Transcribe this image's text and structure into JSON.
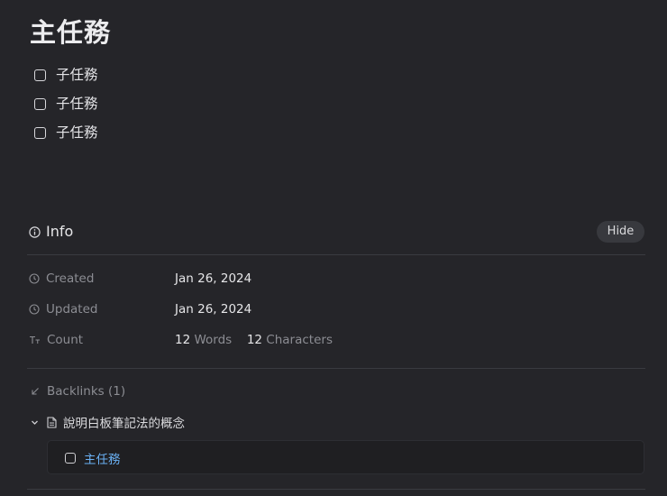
{
  "page": {
    "title": "主任務",
    "todos": [
      {
        "label": "子任務",
        "checked": false
      },
      {
        "label": "子任務",
        "checked": false
      },
      {
        "label": "子任務",
        "checked": false
      }
    ]
  },
  "info": {
    "title": "Info",
    "hide_label": "Hide",
    "created": {
      "label": "Created",
      "value": "Jan 26, 2024"
    },
    "updated": {
      "label": "Updated",
      "value": "Jan 26, 2024"
    },
    "count": {
      "label": "Count",
      "words_value": "12",
      "words_unit": "Words",
      "chars_value": "12",
      "chars_unit": "Characters"
    }
  },
  "backlinks": {
    "title": "Backlinks (1)",
    "doc_title": "說明白板筆記法的概念",
    "item_label": "主任務"
  },
  "colors": {
    "background": "#252529",
    "muted": "#8c8d93",
    "link": "#6ab0f3"
  }
}
